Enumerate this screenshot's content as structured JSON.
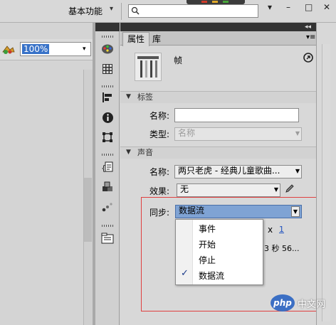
{
  "top_bar": {
    "workspace_label": "基本功能",
    "workspace_caret": "▾",
    "search_placeholder": "",
    "window_controls": [
      "▾",
      "–",
      "□",
      "✕"
    ]
  },
  "stage_toolbar": {
    "zoom_value": "100%",
    "zoom_caret": "▾"
  },
  "panel": {
    "collapse_arrows": "◂◂",
    "tabs": [
      {
        "label": "属性",
        "active": true
      },
      {
        "label": "库",
        "active": false
      }
    ],
    "menu_icon": "▾≡",
    "frame_label": "帧",
    "sections": {
      "label": {
        "title": "标签",
        "name_label": "名称:",
        "name_value": "",
        "type_label": "类型:",
        "type_value": "名称"
      },
      "sound": {
        "title": "声音",
        "name_label": "名称:",
        "name_value": "两只老虎 - 经典儿童歌曲...",
        "effect_label": "效果:",
        "effect_value": "无",
        "sync_label": "同步:",
        "sync_value": "数据流",
        "repeat_x": "x",
        "repeat_count": "1",
        "duration_text": "3 秒 56..."
      }
    },
    "sync_options": [
      {
        "label": "事件",
        "checked": false
      },
      {
        "label": "开始",
        "checked": false
      },
      {
        "label": "停止",
        "checked": false
      },
      {
        "label": "数据流",
        "checked": true
      }
    ],
    "check_glyph": "✓"
  },
  "watermark": {
    "logo": "php",
    "text": "中文网"
  },
  "colors": {
    "highlight": "#e04040",
    "selection": "#3872c8",
    "dropdown_selected_bg": "#7fa3d4"
  }
}
